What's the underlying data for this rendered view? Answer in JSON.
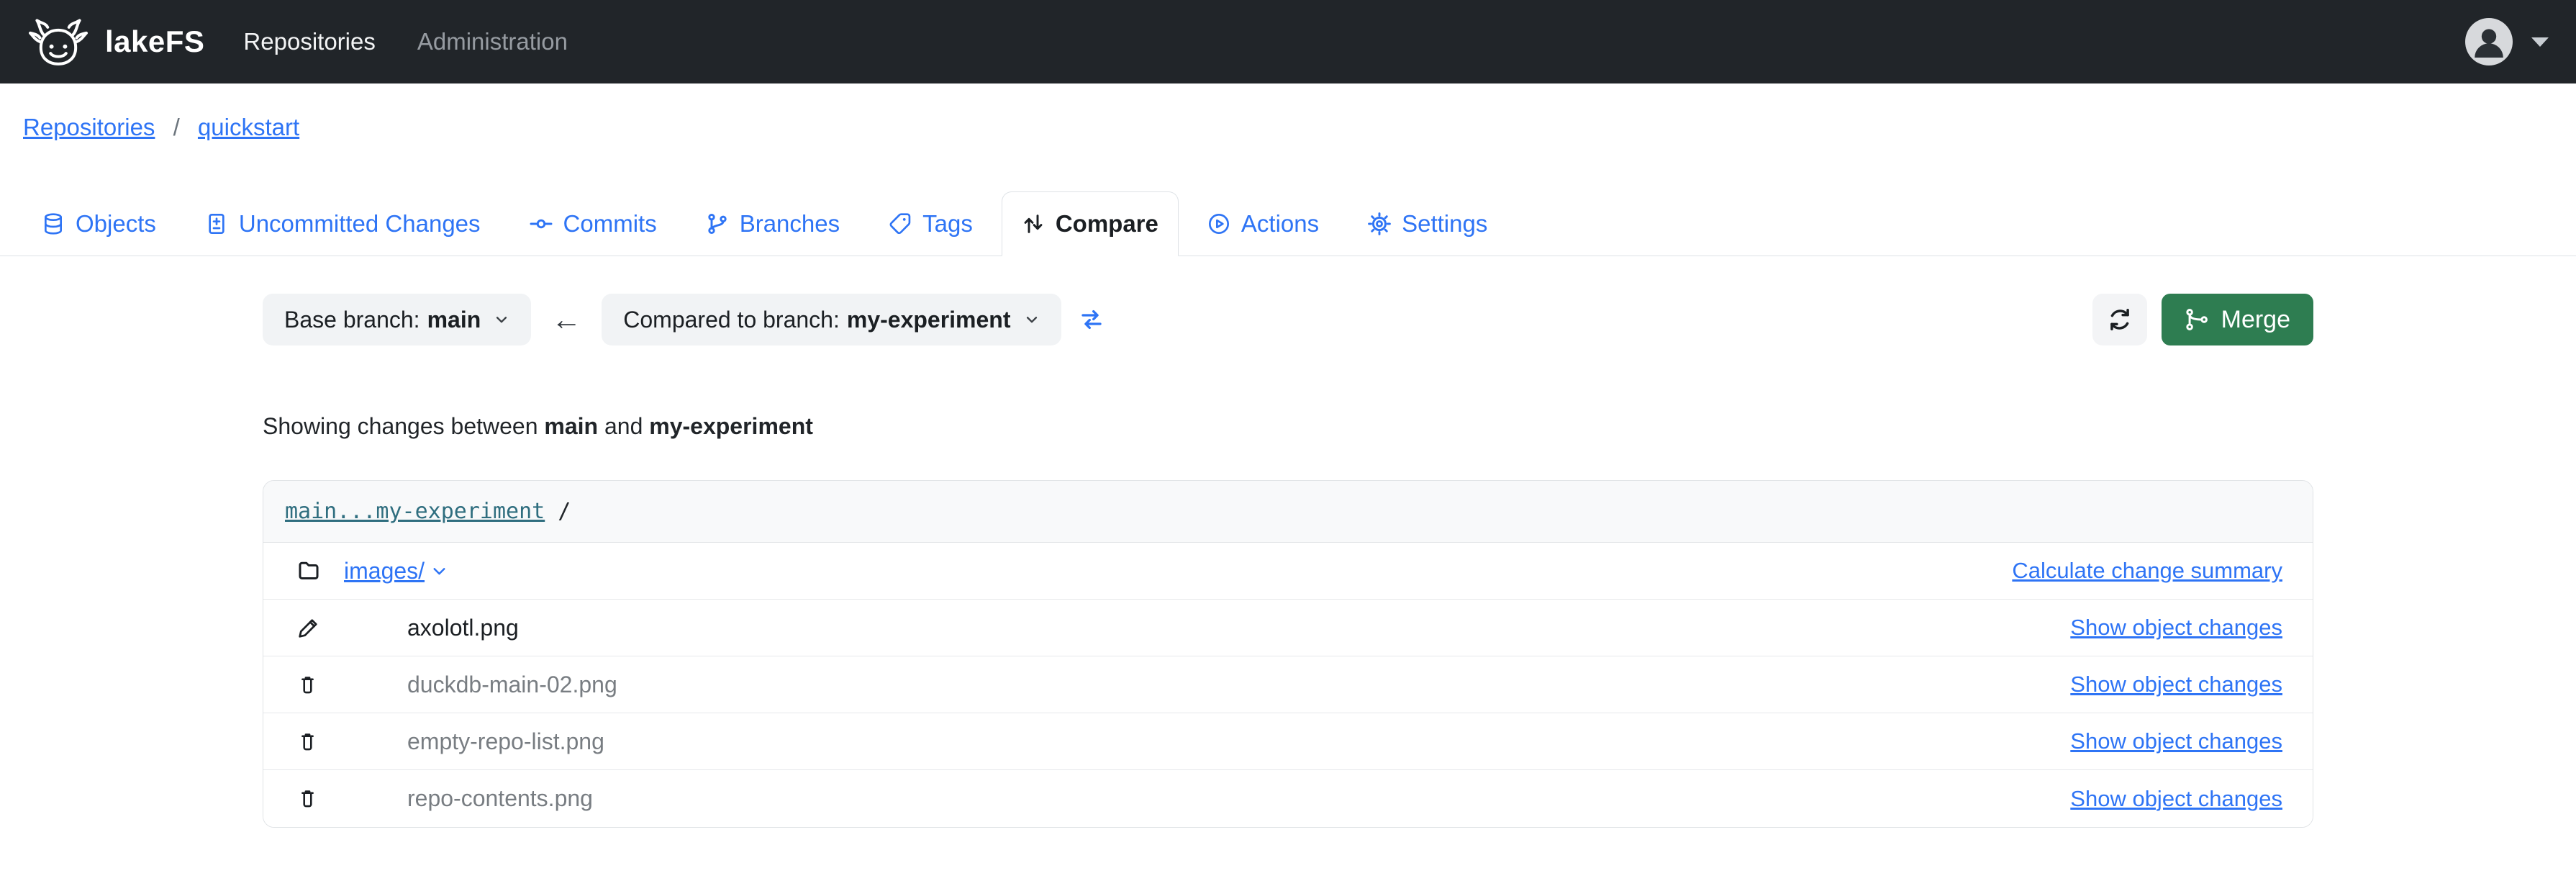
{
  "colors": {
    "navbar_bg": "#212529",
    "accent_blue": "#2e74f5",
    "ref_teal": "#2f6e7f",
    "merge_green": "#2e7d51",
    "deleted_gray": "#787d82"
  },
  "navbar": {
    "brand": "lakeFS",
    "items": [
      {
        "label": "Repositories",
        "active": true
      },
      {
        "label": "Administration",
        "active": false
      }
    ]
  },
  "breadcrumb": {
    "items": [
      "Repositories",
      "quickstart"
    ],
    "separator": "/"
  },
  "tabs": [
    {
      "label": "Objects",
      "icon": "database-icon",
      "active": false
    },
    {
      "label": "Uncommitted Changes",
      "icon": "file-diff-icon",
      "active": false
    },
    {
      "label": "Commits",
      "icon": "commit-icon",
      "active": false
    },
    {
      "label": "Branches",
      "icon": "branch-icon",
      "active": false
    },
    {
      "label": "Tags",
      "icon": "tag-icon",
      "active": false
    },
    {
      "label": "Compare",
      "icon": "compare-icon",
      "active": true
    },
    {
      "label": "Actions",
      "icon": "play-circle-icon",
      "active": false
    },
    {
      "label": "Settings",
      "icon": "gear-icon",
      "active": false
    }
  ],
  "compare": {
    "base_prefix": "Base branch: ",
    "base_branch": "main",
    "compared_prefix": "Compared to branch: ",
    "compared_branch": "my-experiment",
    "merge_label": "Merge"
  },
  "icons": {
    "arrow_left_glyph": "←"
  },
  "summary": {
    "prefix": "Showing changes between ",
    "base": "main",
    "middle": " and ",
    "compared": "my-experiment"
  },
  "diff_card": {
    "ref_link": "main...my-experiment",
    "path_suffix": "/",
    "folder_row": {
      "icon": "folder-icon",
      "name": "images/",
      "action": "Calculate change summary"
    },
    "rows": [
      {
        "icon": "pencil-icon",
        "change": "modified",
        "name": "axolotl.png",
        "action": "Show object changes"
      },
      {
        "icon": "trash-icon",
        "change": "deleted",
        "name": "duckdb-main-02.png",
        "action": "Show object changes"
      },
      {
        "icon": "trash-icon",
        "change": "deleted",
        "name": "empty-repo-list.png",
        "action": "Show object changes"
      },
      {
        "icon": "trash-icon",
        "change": "deleted",
        "name": "repo-contents.png",
        "action": "Show object changes"
      }
    ]
  }
}
